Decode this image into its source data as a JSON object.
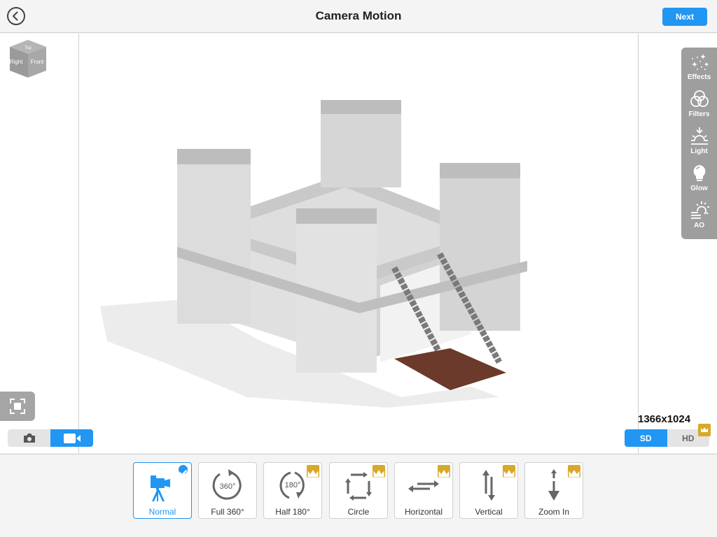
{
  "header": {
    "title": "Camera Motion",
    "next_label": "Next",
    "back_icon": "chevron-left-circle-icon"
  },
  "view_cube": {
    "top": "Top",
    "right": "Right",
    "front": "Front"
  },
  "effects_panel": {
    "items": [
      {
        "label": "Effects",
        "icon": "sparkles-icon"
      },
      {
        "label": "Filters",
        "icon": "filters-circles-icon"
      },
      {
        "label": "Light",
        "icon": "sunrise-icon"
      },
      {
        "label": "Glow",
        "icon": "bulb-icon"
      },
      {
        "label": "AO",
        "icon": "sun-haze-icon"
      }
    ]
  },
  "capture_mode": {
    "options": [
      "photo",
      "video"
    ],
    "selected": "video"
  },
  "resolution": {
    "text": "1366x1024",
    "options": [
      {
        "label": "SD",
        "selected": true,
        "premium": false
      },
      {
        "label": "HD",
        "selected": false,
        "premium": true
      }
    ]
  },
  "motions": [
    {
      "label": "Normal",
      "icon": "camera-tripod-icon",
      "selected": true,
      "premium": false
    },
    {
      "label": "Full 360°",
      "icon": "rotate-360-icon",
      "selected": false,
      "premium": false
    },
    {
      "label": "Half 180°",
      "icon": "rotate-180-icon",
      "selected": false,
      "premium": true
    },
    {
      "label": "Circle",
      "icon": "circle-arrows-icon",
      "selected": false,
      "premium": true
    },
    {
      "label": "Horizontal",
      "icon": "horizontal-arrows-icon",
      "selected": false,
      "premium": true
    },
    {
      "label": "Vertical",
      "icon": "vertical-arrows-icon",
      "selected": false,
      "premium": true
    },
    {
      "label": "Zoom In",
      "icon": "zoom-in-arrow-icon",
      "selected": false,
      "premium": true
    }
  ],
  "colors": {
    "accent": "#2196f3",
    "premium": "#d8a828",
    "panel": "#9e9e9e"
  }
}
